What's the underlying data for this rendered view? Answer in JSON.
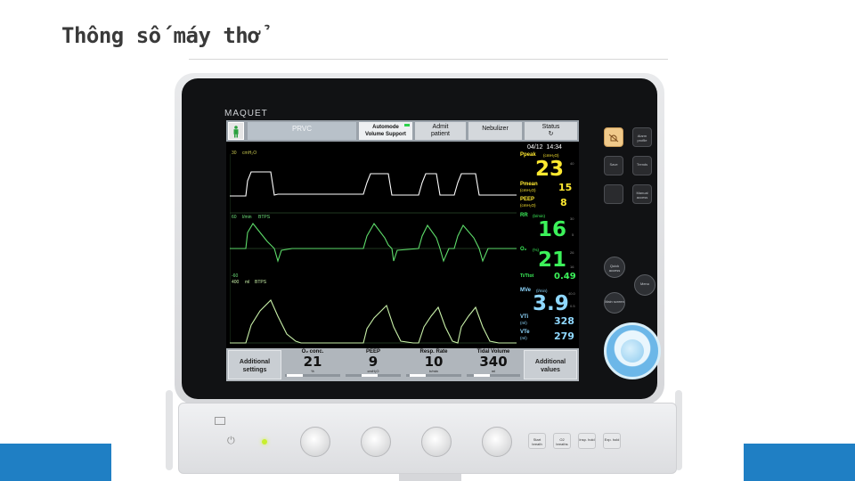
{
  "slide": {
    "title": "Thông số máy thở"
  },
  "device": {
    "brand": "MAQUET",
    "top_bar": {
      "mode": "PRVC",
      "automode_line1": "Automode",
      "automode_line2": "Volume Support",
      "admit_line1": "Admit",
      "admit_line2": "patient",
      "nebulizer": "Nebulizer",
      "status": "Status",
      "status_symbol": "↻"
    },
    "date": "04/12",
    "time": "14:34",
    "waveforms": {
      "pressure": {
        "label_max": "30",
        "unit": "cmH₂O"
      },
      "flow": {
        "label_max": "60",
        "unit": "l/min",
        "unit2": "BTPS",
        "label_min": "-60"
      },
      "volume": {
        "label_max": "400",
        "unit": "ml",
        "unit2": "BTPS"
      }
    },
    "values": {
      "ppeak": {
        "label": "Ppeak",
        "unit": "(cmH₂O)",
        "value": "23",
        "limit": "40"
      },
      "pmean": {
        "label": "Pmean",
        "unit": "(cmH₂O)",
        "value": "15"
      },
      "peep": {
        "label": "PEEP",
        "unit": "(cmH₂O)",
        "value": "8"
      },
      "rr": {
        "label": "RR",
        "unit": "(b/min)",
        "value": "16",
        "limit_high": "30",
        "limit_low": "5"
      },
      "o2": {
        "label": "O₂",
        "unit": "(%)",
        "value": "21",
        "limit_high": "26",
        "limit_low": "16"
      },
      "titot": {
        "label": "Ti/Ttot",
        "value": "0.49"
      },
      "mve": {
        "label": "MVe",
        "unit": "(l/min)",
        "value": "3.9",
        "limit_high": "40.0",
        "limit_low": "0.5"
      },
      "vti": {
        "label": "VTi",
        "unit": "(ml)",
        "value": "328"
      },
      "vte": {
        "label": "VTe",
        "unit": "(ml)",
        "value": "279"
      }
    },
    "bottom_bar": {
      "additional_settings_line1": "Additional",
      "additional_settings_line2": "settings",
      "o2_conc": {
        "label": "O₂ conc.",
        "value": "21",
        "unit": "%",
        "slider": 0.05
      },
      "peep": {
        "label": "PEEP",
        "value": "9",
        "unit": "cmH₂O",
        "slider": 0.4
      },
      "resp_rate": {
        "label": "Resp. Rate",
        "value": "10",
        "unit": "b/min",
        "slider": 0.1
      },
      "tidal_volume": {
        "label": "Tidal Volume",
        "value": "340",
        "unit": "ml",
        "slider": 0.2
      },
      "additional_values_line1": "Additional",
      "additional_values_line2": "values"
    },
    "side_keys": {
      "alarm_silence": "",
      "alarm_profile": "Alarm profile",
      "save": "Save",
      "trends": "Trends",
      "blank": "",
      "manual_access": "Manual access",
      "quick_access": "Quick access",
      "menu": "Menu",
      "main_screen": "Main screen"
    },
    "strip_keys": {
      "start_breath": "Start breath",
      "o2_breaths": "O2 breaths",
      "insp_hold": "Insp. hold",
      "exp_hold": "Exp. hold"
    },
    "colors": {
      "pressure_value": "#ffe930",
      "rr_value": "#3cf25a",
      "mve_value": "#8fd8ff",
      "accent_blue": "#1f7fc4",
      "knob": "#6cb7e8"
    }
  }
}
